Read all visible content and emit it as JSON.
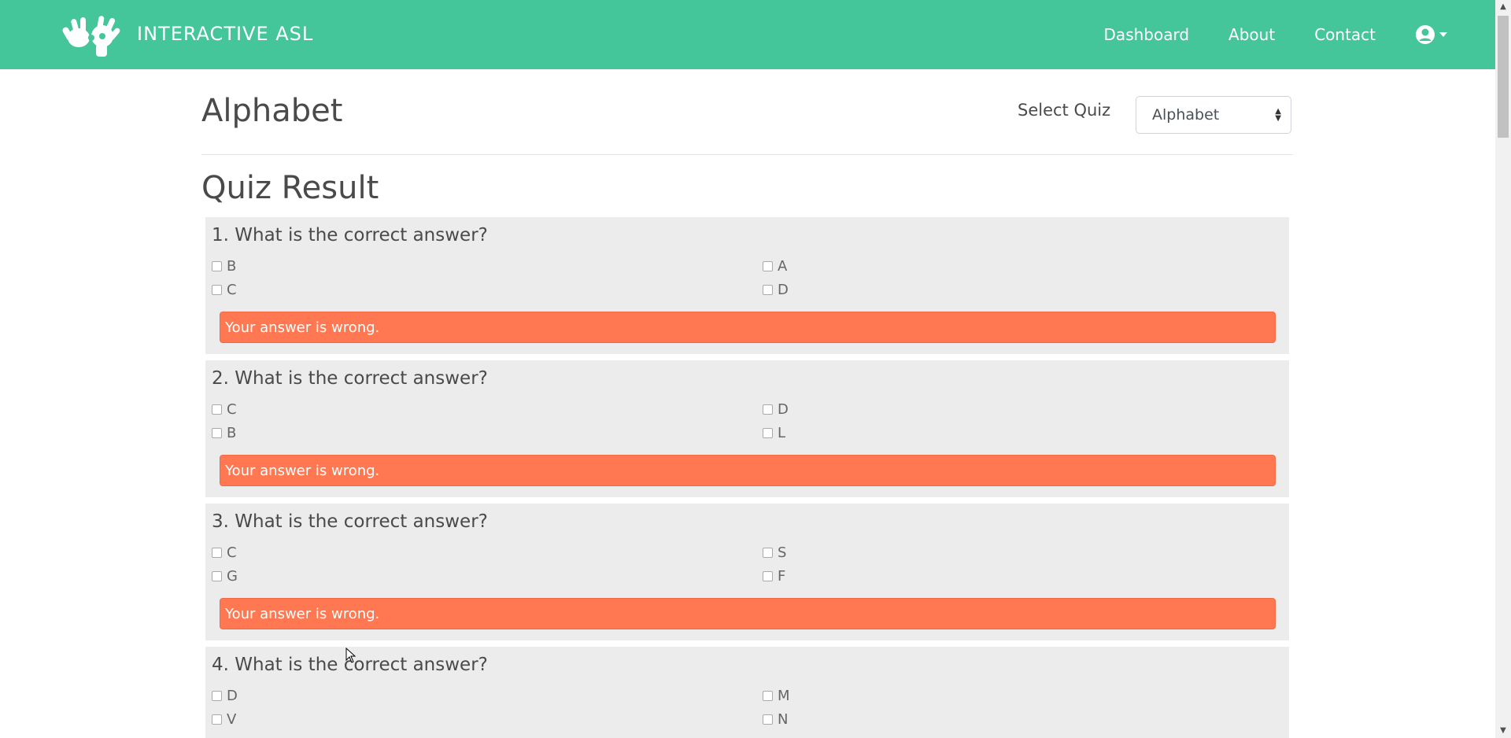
{
  "nav": {
    "brand": "INTERACTIVE ASL",
    "links": [
      "Dashboard",
      "About",
      "Contact"
    ],
    "logo_icon": "asl-hands-icon",
    "user_icon": "user-circle-icon"
  },
  "page": {
    "title": "Alphabet",
    "select_label": "Select Quiz",
    "select_value": "Alphabet",
    "section_title": "Quiz Result"
  },
  "questions": [
    {
      "text": "1. What is the correct answer?",
      "options": [
        "B",
        "A",
        "C",
        "D"
      ],
      "result": "Your answer is wrong."
    },
    {
      "text": "2. What is the correct answer?",
      "options": [
        "C",
        "D",
        "B",
        "L"
      ],
      "result": "Your answer is wrong."
    },
    {
      "text": "3. What is the correct answer?",
      "options": [
        "C",
        "S",
        "G",
        "F"
      ],
      "result": "Your answer is wrong."
    },
    {
      "text": "4. What is the correct answer?",
      "options": [
        "D",
        "M",
        "V",
        "N"
      ],
      "result": ""
    }
  ],
  "colors": {
    "nav_bg": "#45c59a",
    "wrong_bg": "#ff7851",
    "question_bg": "#ececec"
  }
}
